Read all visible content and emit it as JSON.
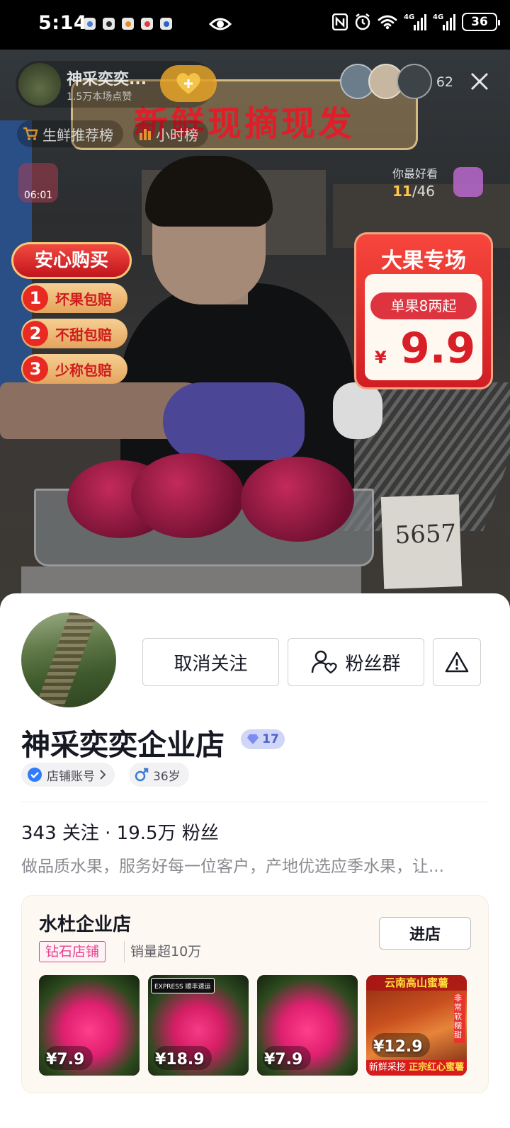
{
  "status_bar": {
    "time": "5:14",
    "network_1": "4G",
    "network_2": "4G",
    "battery": "36"
  },
  "live": {
    "banner_title": "新鲜现摘现发",
    "host_name": "神采奕奕...",
    "host_likes": "1.5万本场点赞",
    "viewer_count": "62",
    "rank_1": "生鲜推荐榜",
    "rank_2": "小时榜",
    "timer": "06:01",
    "recommend_label": "你最好看",
    "recommend_index": "11",
    "recommend_total": "/46",
    "note_text": "5657",
    "guarantee": {
      "title": "安心购买",
      "items": [
        {
          "num": "1",
          "text": "坏果包赔"
        },
        {
          "num": "2",
          "text": "不甜包赔"
        },
        {
          "num": "3",
          "text": "少称包赔"
        }
      ]
    },
    "promo": {
      "title": "大果专场",
      "tag": "单果8两起",
      "currency": "¥",
      "price": "9.9"
    }
  },
  "profile": {
    "unfollow_label": "取消关注",
    "fan_group_label": "粉丝群",
    "name": "神采奕奕企业店",
    "level": "17",
    "account_type": "店铺账号",
    "age": "36岁",
    "stats": "343 关注 · 19.5万 粉丝",
    "bio": "做品质水果，服务好每一位客户，产地优选应季水果，让..."
  },
  "store": {
    "name": "水杜企业店",
    "tag": "钻石店铺",
    "sales": "销量超10万",
    "enter_label": "进店",
    "products": [
      {
        "price": "¥7.9"
      },
      {
        "price": "¥18.9",
        "badge": "EXPRESS 顺丰速运"
      },
      {
        "price": "¥7.9"
      },
      {
        "price": "¥12.9",
        "top": "云南高山蜜薯",
        "side": "非常软糯甜",
        "bottom_1": "新鲜采挖",
        "bottom_2": "正宗红心蜜薯"
      }
    ]
  },
  "colors": {
    "brand_red": "#e01e2a",
    "tag_pink": "#e5428c",
    "level_blue": "#5163c7",
    "verified_blue": "#2f7bff"
  }
}
